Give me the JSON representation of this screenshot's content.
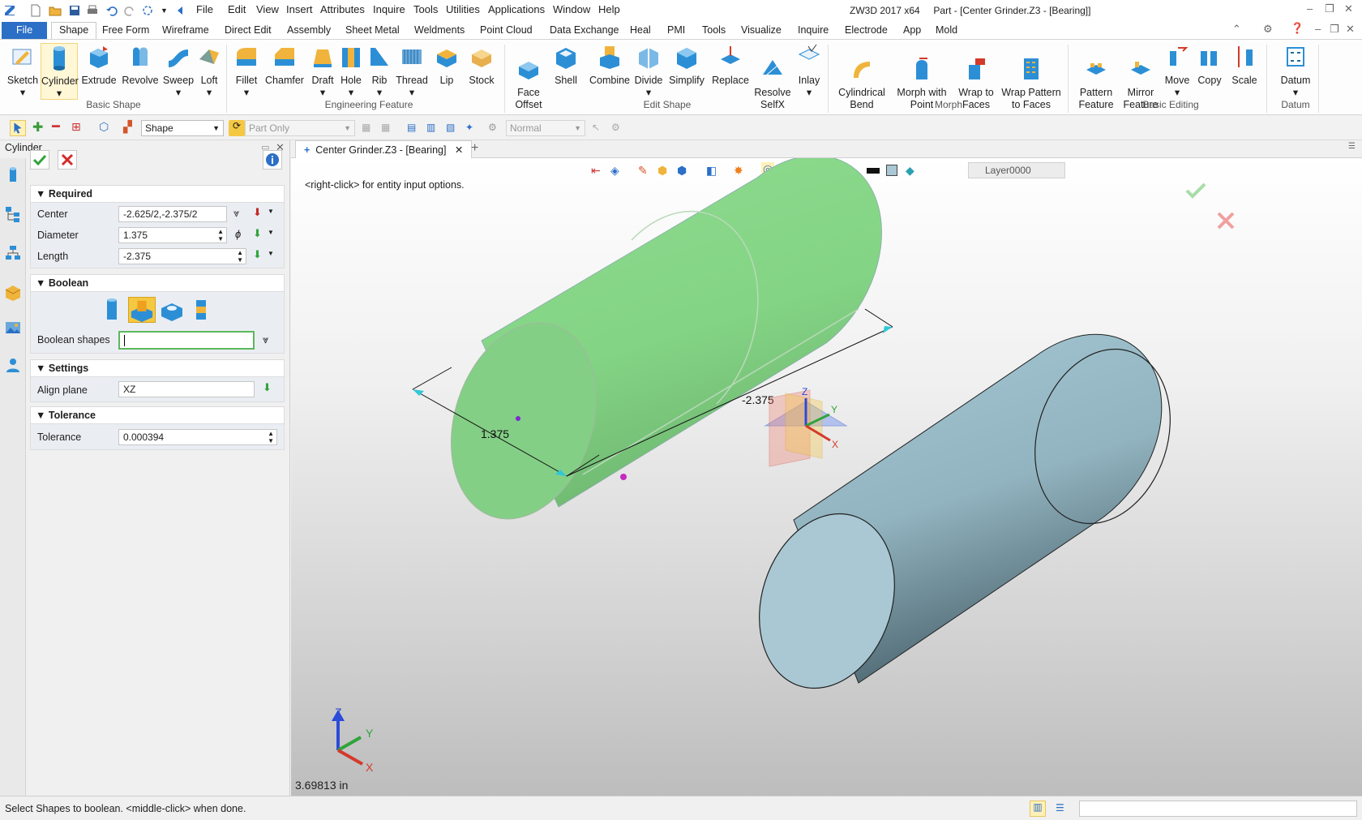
{
  "menu": {
    "items": [
      "File",
      "Edit",
      "View",
      "Insert",
      "Attributes",
      "Inquire",
      "Tools",
      "Utilities",
      "Applications",
      "Window",
      "Help"
    ]
  },
  "title": {
    "app": "ZW3D 2017  x64",
    "document": "Part - [Center Grinder.Z3 - [Bearing]]"
  },
  "ribbon_tabs": [
    "File",
    "Shape",
    "Free Form",
    "Wireframe",
    "Direct Edit",
    "Assembly",
    "Sheet Metal",
    "Weldments",
    "Point Cloud",
    "Data Exchange",
    "Heal",
    "PMI",
    "Tools",
    "Visualize",
    "Inquire",
    "Electrode",
    "App",
    "Mold"
  ],
  "ribbon": {
    "basic_shape": {
      "label": "Basic Shape",
      "buttons": [
        "Sketch",
        "Cylinder",
        "Extrude",
        "Revolve",
        "Sweep",
        "Loft"
      ]
    },
    "engineering_feature": {
      "label": "Engineering Feature",
      "buttons": [
        "Fillet",
        "Chamfer",
        "Draft",
        "Hole",
        "Rib",
        "Thread",
        "Lip",
        "Stock"
      ]
    },
    "edit_shape": {
      "label": "Edit Shape",
      "buttons": [
        "Face\nOffset",
        "Shell",
        "Combine",
        "Divide",
        "Simplify",
        "Replace",
        "Resolve\nSelfX",
        "Inlay"
      ]
    },
    "morph": {
      "label": "Morph",
      "buttons": [
        "Cylindrical\nBend",
        "Morph with\nPoint",
        "Wrap to\nFaces",
        "Wrap Pattern\nto Faces"
      ]
    },
    "basic_editing": {
      "label": "Basic Editing",
      "buttons": [
        "Pattern\nFeature",
        "Mirror\nFeature",
        "Move",
        "Copy",
        "Scale"
      ]
    },
    "datum": {
      "label": "Datum",
      "buttons": [
        "Datum"
      ]
    }
  },
  "toolbar": {
    "filter_select": "Shape",
    "scope_select": "Part Only",
    "render_select": "Normal"
  },
  "panel": {
    "title": "Cylinder",
    "required_header": "Required",
    "center_label": "Center",
    "center_value": "-2.625/2,-2.375/2",
    "diameter_label": "Diameter",
    "diameter_value": "1.375",
    "length_label": "Length",
    "length_value": "-2.375",
    "boolean_header": "Boolean",
    "boolean_shapes_label": "Boolean shapes",
    "settings_header": "Settings",
    "align_plane_label": "Align plane",
    "align_plane_value": "XZ",
    "tolerance_header": "Tolerance",
    "tolerance_label": "Tolerance",
    "tolerance_value": "0.000394"
  },
  "doc_tab": {
    "label": "Center Grinder.Z3 - [Bearing]"
  },
  "viewport": {
    "hint": "<right-click> for entity input options.",
    "dim_diameter": "1.375",
    "dim_length": "-2.375",
    "measure": "3.69813 in",
    "layer": "Layer0000",
    "axis_x": "X",
    "axis_y": "Y",
    "axis_z": "Z"
  },
  "status": {
    "text": "Select Shapes to boolean.  <middle-click> when done."
  },
  "colors": {
    "accent": "#2b6fc6",
    "green_cylinder": "#86d688",
    "blue_cylinder": "#a9c8d3",
    "ok_green": "#2fa43a",
    "cancel_red": "#d32a2a"
  }
}
